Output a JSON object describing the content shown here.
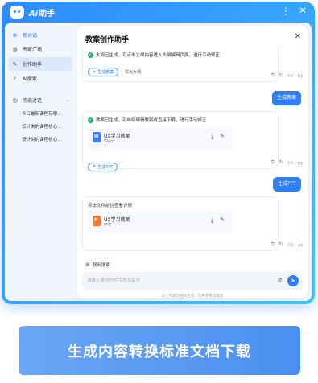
{
  "app": {
    "logo_text": "Ai",
    "title": "助手",
    "more_icon": "more-vertical-icon",
    "close_icon": "close-icon"
  },
  "sidebar": {
    "items": [
      {
        "label": "新对话",
        "icon": "plus-circle-icon"
      },
      {
        "label": "专家广场",
        "icon": "planet-icon"
      },
      {
        "label": "创作助手",
        "icon": "pen-sparkle-icon"
      },
      {
        "label": "AI搜索",
        "icon": "search-icon"
      }
    ],
    "history_label": "历史对话",
    "history_items": [
      "今日最新课程有哪...",
      "设计类的课程核心...",
      "设计类的课程核心..."
    ]
  },
  "main": {
    "title": "教案创作助手",
    "msg1": {
      "text": "大纲已生成，可点击大纲内容进入大纲编辑页面，进行手动修正",
      "pill": "生成教案",
      "link": "优化大纲"
    },
    "user1": "生成教案",
    "msg2": {
      "text": "教案已生成，可继续编辑教案或直接下载，进行手动修正",
      "file_name": "UX学习教案",
      "file_type": "Word",
      "pill": "生成PPT"
    },
    "user2": "生成PPT",
    "msg3": {
      "text": "点击文件前往查看详情",
      "file_name": "UX学习教案",
      "file_type": "PPT"
    },
    "web_search": "联网搜索",
    "input_placeholder": "请输入要创作的主题及需求",
    "disclaimer": "以上内容均由AI生成，仅供参考和借鉴"
  },
  "banner": {
    "text": "生成内容转换标准文档下载"
  },
  "colors": {
    "accent": "#2f7ef6",
    "frame": "#2e8bff",
    "success": "#1fb36a",
    "ppt": "#f27a3c",
    "word": "#3d7cf5"
  }
}
